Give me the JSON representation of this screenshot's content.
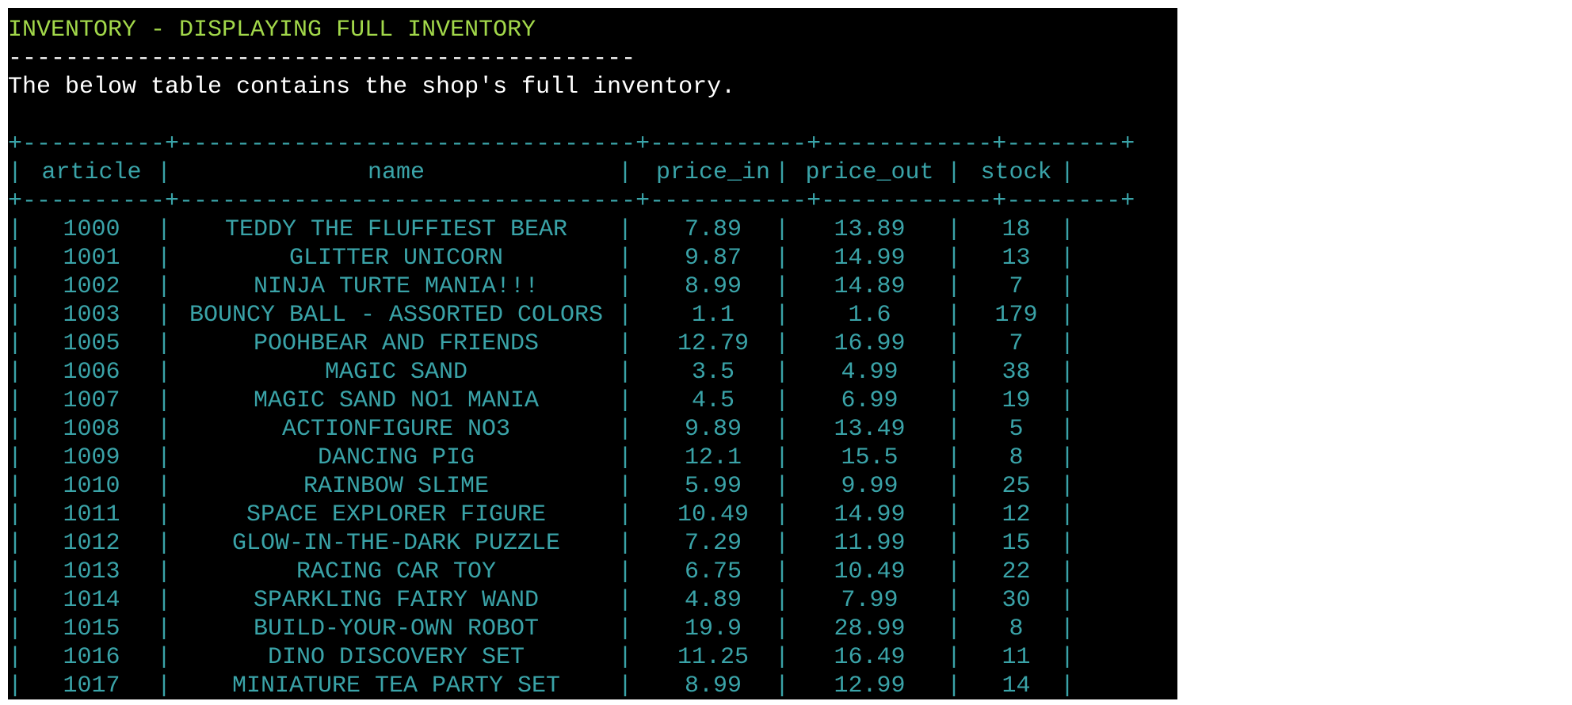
{
  "terminal": {
    "title": "INVENTORY - DISPLAYING FULL INVENTORY",
    "underline": "--------------------------------------------",
    "description": "The below table contains the shop's full inventory."
  },
  "table": {
    "border_top": "+----------+--------------------------------+-----------+------------+--------+",
    "border_mid": "+----------+--------------------------------+-----------+------------+--------+",
    "headers": [
      "article",
      "name",
      "price_in",
      "price_out",
      "stock"
    ],
    "rows": [
      {
        "article": "1000",
        "name": "TEDDY THE FLUFFIEST BEAR",
        "price_in": "7.89",
        "price_out": "13.89",
        "stock": "18"
      },
      {
        "article": "1001",
        "name": "GLITTER UNICORN",
        "price_in": "9.87",
        "price_out": "14.99",
        "stock": "13"
      },
      {
        "article": "1002",
        "name": "NINJA TURTE MANIA!!!",
        "price_in": "8.99",
        "price_out": "14.89",
        "stock": "7"
      },
      {
        "article": "1003",
        "name": "BOUNCY BALL - ASSORTED COLORS",
        "price_in": "1.1",
        "price_out": "1.6",
        "stock": "179"
      },
      {
        "article": "1005",
        "name": "POOHBEAR AND FRIENDS",
        "price_in": "12.79",
        "price_out": "16.99",
        "stock": "7"
      },
      {
        "article": "1006",
        "name": "MAGIC SAND",
        "price_in": "3.5",
        "price_out": "4.99",
        "stock": "38"
      },
      {
        "article": "1007",
        "name": "MAGIC SAND NO1 MANIA",
        "price_in": "4.5",
        "price_out": "6.99",
        "stock": "19"
      },
      {
        "article": "1008",
        "name": "ACTIONFIGURE NO3",
        "price_in": "9.89",
        "price_out": "13.49",
        "stock": "5"
      },
      {
        "article": "1009",
        "name": "DANCING PIG",
        "price_in": "12.1",
        "price_out": "15.5",
        "stock": "8"
      },
      {
        "article": "1010",
        "name": "RAINBOW SLIME",
        "price_in": "5.99",
        "price_out": "9.99",
        "stock": "25"
      },
      {
        "article": "1011",
        "name": "SPACE EXPLORER FIGURE",
        "price_in": "10.49",
        "price_out": "14.99",
        "stock": "12"
      },
      {
        "article": "1012",
        "name": "GLOW-IN-THE-DARK PUZZLE",
        "price_in": "7.29",
        "price_out": "11.99",
        "stock": "15"
      },
      {
        "article": "1013",
        "name": "RACING CAR TOY",
        "price_in": "6.75",
        "price_out": "10.49",
        "stock": "22"
      },
      {
        "article": "1014",
        "name": "SPARKLING FAIRY WAND",
        "price_in": "4.89",
        "price_out": "7.99",
        "stock": "30"
      },
      {
        "article": "1015",
        "name": "BUILD-YOUR-OWN ROBOT",
        "price_in": "19.9",
        "price_out": "28.99",
        "stock": "8"
      },
      {
        "article": "1016",
        "name": "DINO DISCOVERY SET",
        "price_in": "11.25",
        "price_out": "16.49",
        "stock": "11"
      },
      {
        "article": "1017",
        "name": "MINIATURE TEA PARTY SET",
        "price_in": "8.99",
        "price_out": "12.99",
        "stock": "14"
      }
    ]
  }
}
